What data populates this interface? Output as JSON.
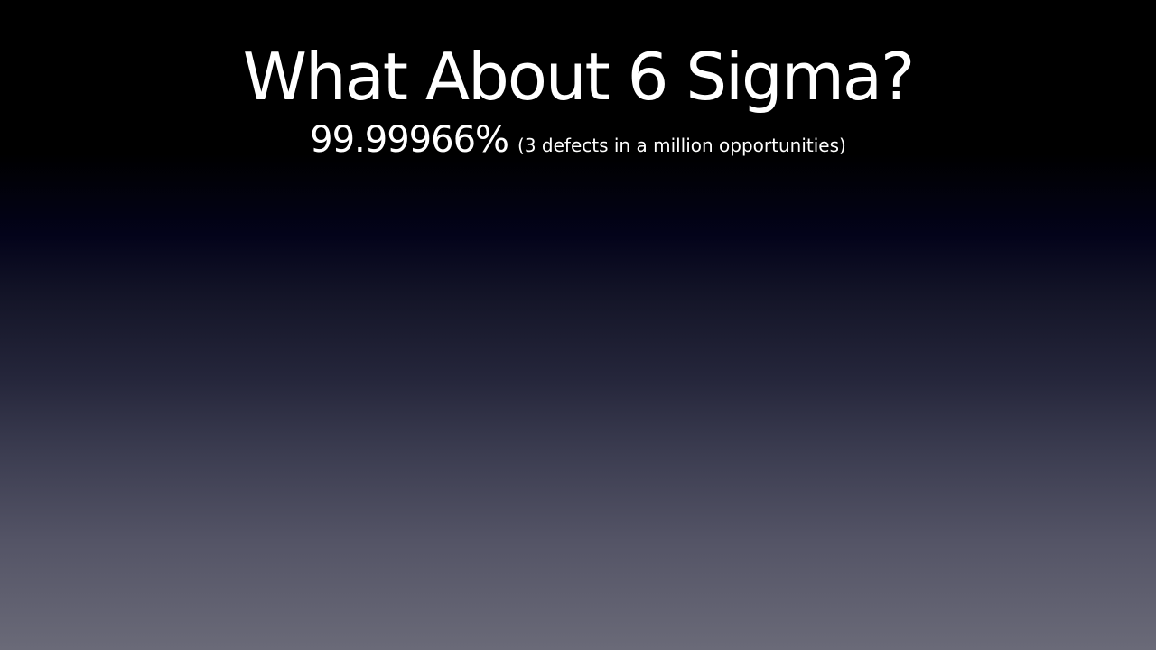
{
  "slide": {
    "title": "What About 6 Sigma?",
    "subtitle_value": "99.99966%",
    "subtitle_note": "(3 defects in a million opportunities)"
  },
  "colors": {
    "text": "#ffffff",
    "background_top": "#000000",
    "background_bottom": "#6a6a78"
  }
}
